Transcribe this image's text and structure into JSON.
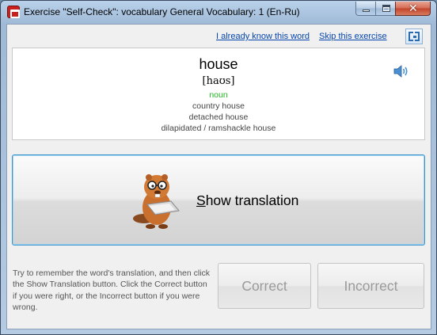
{
  "window": {
    "title": "Exercise \"Self-Check\": vocabulary General Vocabulary: 1 (En-Ru)",
    "close_glyph": "✕"
  },
  "links": {
    "already_know": "I already know this word",
    "skip": "Skip this exercise"
  },
  "card": {
    "word": "house",
    "transcription": "[haʊs]",
    "part_of_speech": "noun",
    "examples": [
      "country house",
      "detached house",
      "dilapidated / ramshackle house"
    ]
  },
  "show_translation": {
    "mnemonic_letter": "S",
    "label_rest": "how translation"
  },
  "hint": "Try to remember the word's translation, and then click the Show Translation button. Click the Correct button if you were right, or the Incorrect button if you were wrong.",
  "buttons": {
    "correct": "Correct",
    "incorrect": "Incorrect"
  },
  "icons": {
    "app": "app-icon",
    "speaker": "speaker-icon",
    "fullscreen": "fullscreen-icon",
    "mascot": "beaver-mascot"
  },
  "colors": {
    "link": "#0645ad",
    "part_of_speech": "#22b522",
    "focus_border": "#3c94c9",
    "disabled_text": "#9a9a9a"
  }
}
